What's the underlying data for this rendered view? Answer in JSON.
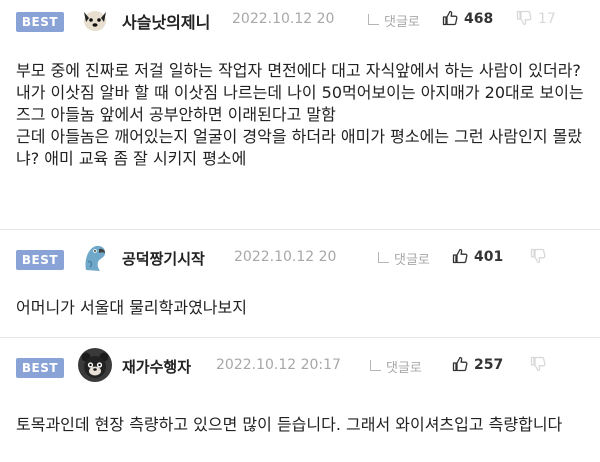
{
  "comments": [
    {
      "badge": "BEST",
      "nickname": "사슬낫의제니",
      "time": "2022.10.12 20",
      "reply_label": "댓글로",
      "likes": "468",
      "dislikes": "17",
      "text": "부모 중에 진짜로 저걸 일하는 작업자 면전에다 대고 자식앞에서 하는 사람이 있더라?\n내가 이삿짐 알바 할 때 이삿짐 나르는데 나이 50먹어보이는 아지매가 20대로 보이는 즈그 아들놈 앞에서 공부안하면 이래된다고 말함\n근데 아들놈은 깨어있는지 얼굴이 경악을 하더라 애미가 평소에는 그런 사람인지 몰랐냐? 애미 교육 좀 잘 시키지 평소에"
    },
    {
      "badge": "BEST",
      "nickname": "공덕짱기시작",
      "time": "2022.10.12 20",
      "reply_label": "댓글로",
      "likes": "401",
      "dislikes": "",
      "text": "어머니가 서울대 물리학과였나보지"
    },
    {
      "badge": "BEST",
      "nickname": "재가수행자",
      "time": "2022.10.12 20:17",
      "reply_label": "댓글로",
      "likes": "257",
      "dislikes": "",
      "text": "토목과인데 현장 측량하고 있으면 많이 듣습니다. 그래서 와이셔츠입고 측량합니다"
    }
  ],
  "icons": {
    "like": "thumbs-up-icon",
    "dislike": "thumbs-down-icon",
    "reply": "reply-arrow-icon",
    "more": "more-icon"
  },
  "colors": {
    "badge_bg": "#8aa3d6",
    "meta_text": "#a8a8a8"
  }
}
